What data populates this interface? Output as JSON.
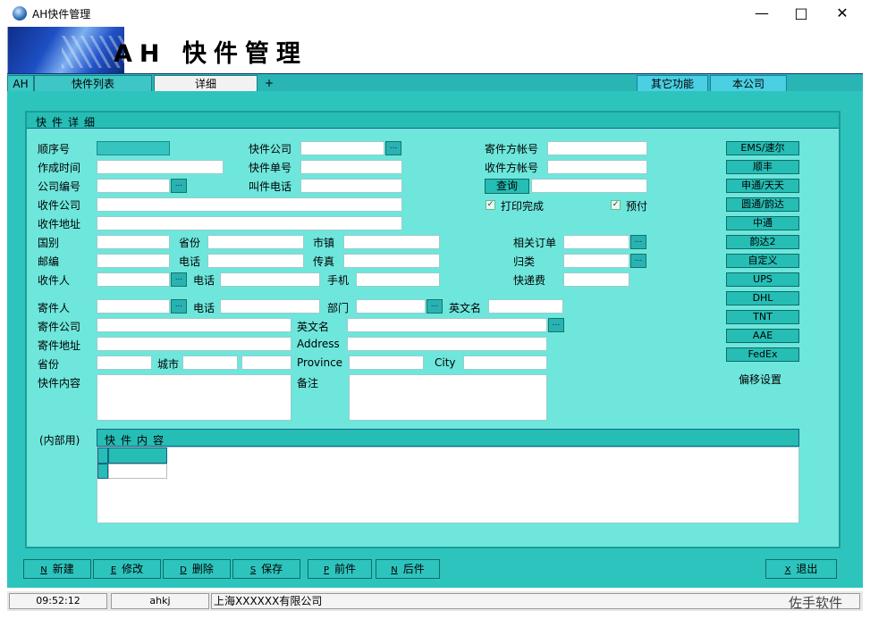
{
  "window": {
    "title": "AH快件管理"
  },
  "banner": {
    "title": "AH 快件管理"
  },
  "tabs": {
    "ah": "AH",
    "list": "快件列表",
    "detail": "详细",
    "plus": "+",
    "other": "其它功能",
    "company": "本公司"
  },
  "panel": {
    "title": "快件详细"
  },
  "form": {
    "seq": "顺序号",
    "created": "作成时间",
    "company_no": "公司编号",
    "recv_company": "收件公司",
    "recv_addr": "收件地址",
    "country": "国别",
    "province": "省份",
    "town": "市镇",
    "zip": "邮编",
    "phone": "电话",
    "fax": "传真",
    "receiver": "收件人",
    "phone2": "电话",
    "mobile": "手机",
    "express_company": "快件公司",
    "express_no": "快件单号",
    "call_phone": "叫件电话",
    "sender_acct": "寄件方帐号",
    "recv_acct": "收件方帐号",
    "query": "查询",
    "print_done": "打印完成",
    "prepaid": "预付",
    "order": "相关订单",
    "category": "归类",
    "fee": "快递费",
    "sender": "寄件人",
    "phone3": "电话",
    "dept": "部门",
    "en_name": "英文名",
    "send_company": "寄件公司",
    "en_name2": "英文名",
    "send_addr": "寄件地址",
    "address_en": "Address",
    "province2": "省份",
    "city": "城市",
    "province_en": "Province",
    "city_en": "City",
    "content": "快件内容",
    "remark": "备注",
    "internal": "(内部用)",
    "grid_title": "快件内容"
  },
  "carriers": [
    "EMS/速尔",
    "顺丰",
    "申通/天天",
    "圆通/韵达",
    "中通",
    "韵达2",
    "自定义",
    "UPS",
    "DHL",
    "TNT",
    "AAE",
    "FedEx"
  ],
  "offset": "偏移设置",
  "buttons": {
    "new": {
      "key": "N",
      "label": "新建"
    },
    "edit": {
      "key": "E",
      "label": "修改"
    },
    "del": {
      "key": "D",
      "label": "删除"
    },
    "save": {
      "key": "S",
      "label": "保存"
    },
    "prev": {
      "key": "P",
      "label": "前件"
    },
    "next": {
      "key": "N",
      "label": "后件"
    },
    "exit": {
      "key": "X",
      "label": "退出"
    }
  },
  "status": {
    "time": "09:52:12",
    "user": "ahkj",
    "company": "上海XXXXXX有限公司"
  },
  "watermark": "佐手软件"
}
